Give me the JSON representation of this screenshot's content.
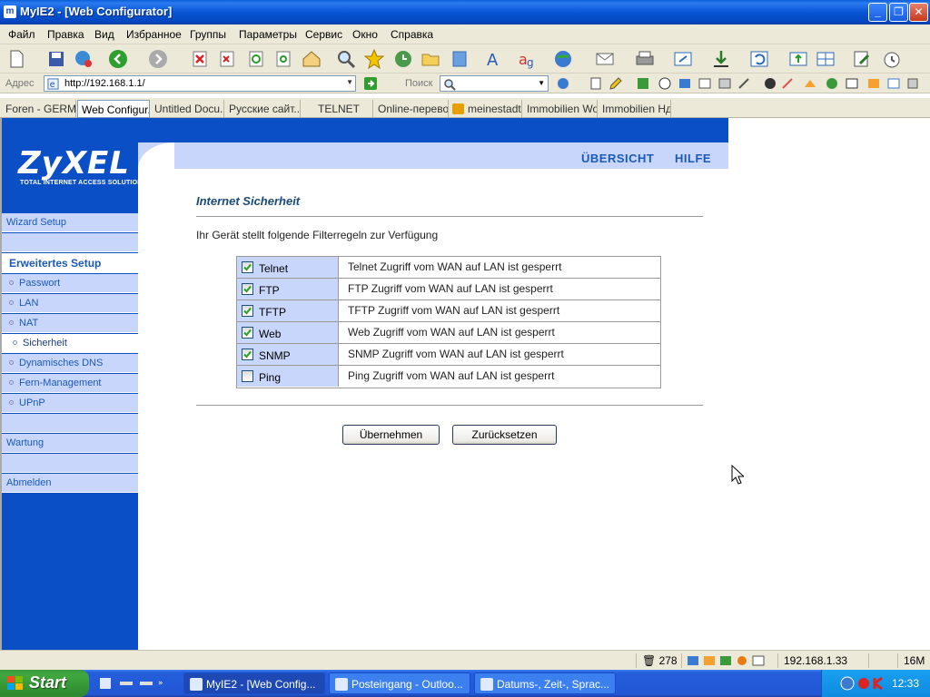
{
  "window": {
    "title": "MyIE2 - [Web Configurator]"
  },
  "menu": [
    "Файл",
    "Правка",
    "Вид",
    "Избранное",
    "Группы",
    "Параметры",
    "Сервис",
    "Окно",
    "Справка"
  ],
  "address": {
    "label": "Адрес",
    "url": "http://192.168.1.1/",
    "search_label": "Поиск"
  },
  "tabs": [
    "Foren - GERM...",
    "Web Configur...",
    "Untitled Docu...",
    "Русские сайт...",
    "TELNET",
    "Online-перево...",
    "meinestadt...",
    "Immobilien Wo...",
    "Immobilien Нд..."
  ],
  "router": {
    "logo_brand": "ZyXEL",
    "logo_tagline": "TOTAL INTERNET ACCESS SOLUTION",
    "nav": {
      "overview": "ÜBERSICHT",
      "help": "HILFE"
    },
    "sidebar": {
      "wizard": "Wizard Setup",
      "advanced_header": "Erweitertes Setup",
      "password": "Passwort",
      "lan": "LAN",
      "nat": "NAT",
      "security": "Sicherheit",
      "ddns": "Dynamisches DNS",
      "remote": "Fern-Management",
      "upnp": "UPnP",
      "maintenance": "Wartung",
      "logout": "Abmelden"
    },
    "section_title": "Internet Sicherheit",
    "description": "Ihr Gerät stellt folgende Filterregeln zur Verfügung",
    "filters": [
      {
        "name": "Telnet",
        "checked": true,
        "text": "Telnet Zugriff vom WAN auf LAN ist gesperrt"
      },
      {
        "name": "FTP",
        "checked": true,
        "text": "FTP Zugriff vom WAN auf LAN ist gesperrt"
      },
      {
        "name": "TFTP",
        "checked": true,
        "text": "TFTP Zugriff vom WAN auf LAN ist gesperrt"
      },
      {
        "name": "Web",
        "checked": true,
        "text": "Web Zugriff vom WAN auf LAN ist gesperrt"
      },
      {
        "name": "SNMP",
        "checked": true,
        "text": "SNMP Zugriff vom WAN auf LAN ist gesperrt"
      },
      {
        "name": "Ping",
        "checked": false,
        "text": "Ping Zugriff vom WAN auf LAN ist gesperrt"
      }
    ],
    "apply_button": "Übernehmen",
    "reset_button": "Zurücksetzen"
  },
  "status": {
    "count": "278",
    "ip": "192.168.1.33",
    "memory": "16M"
  },
  "taskbar": {
    "start": "Start",
    "tasks": [
      "MyIE2 - [Web Config...",
      "Posteingang - Outloo...",
      "Datums-, Zeit-, Sprac..."
    ],
    "clock": "12:33"
  },
  "colors": {
    "zyxel_blue": "#0b4fc6",
    "panel_light": "#c9d6fb",
    "nav_text": "#1a5ab8"
  }
}
